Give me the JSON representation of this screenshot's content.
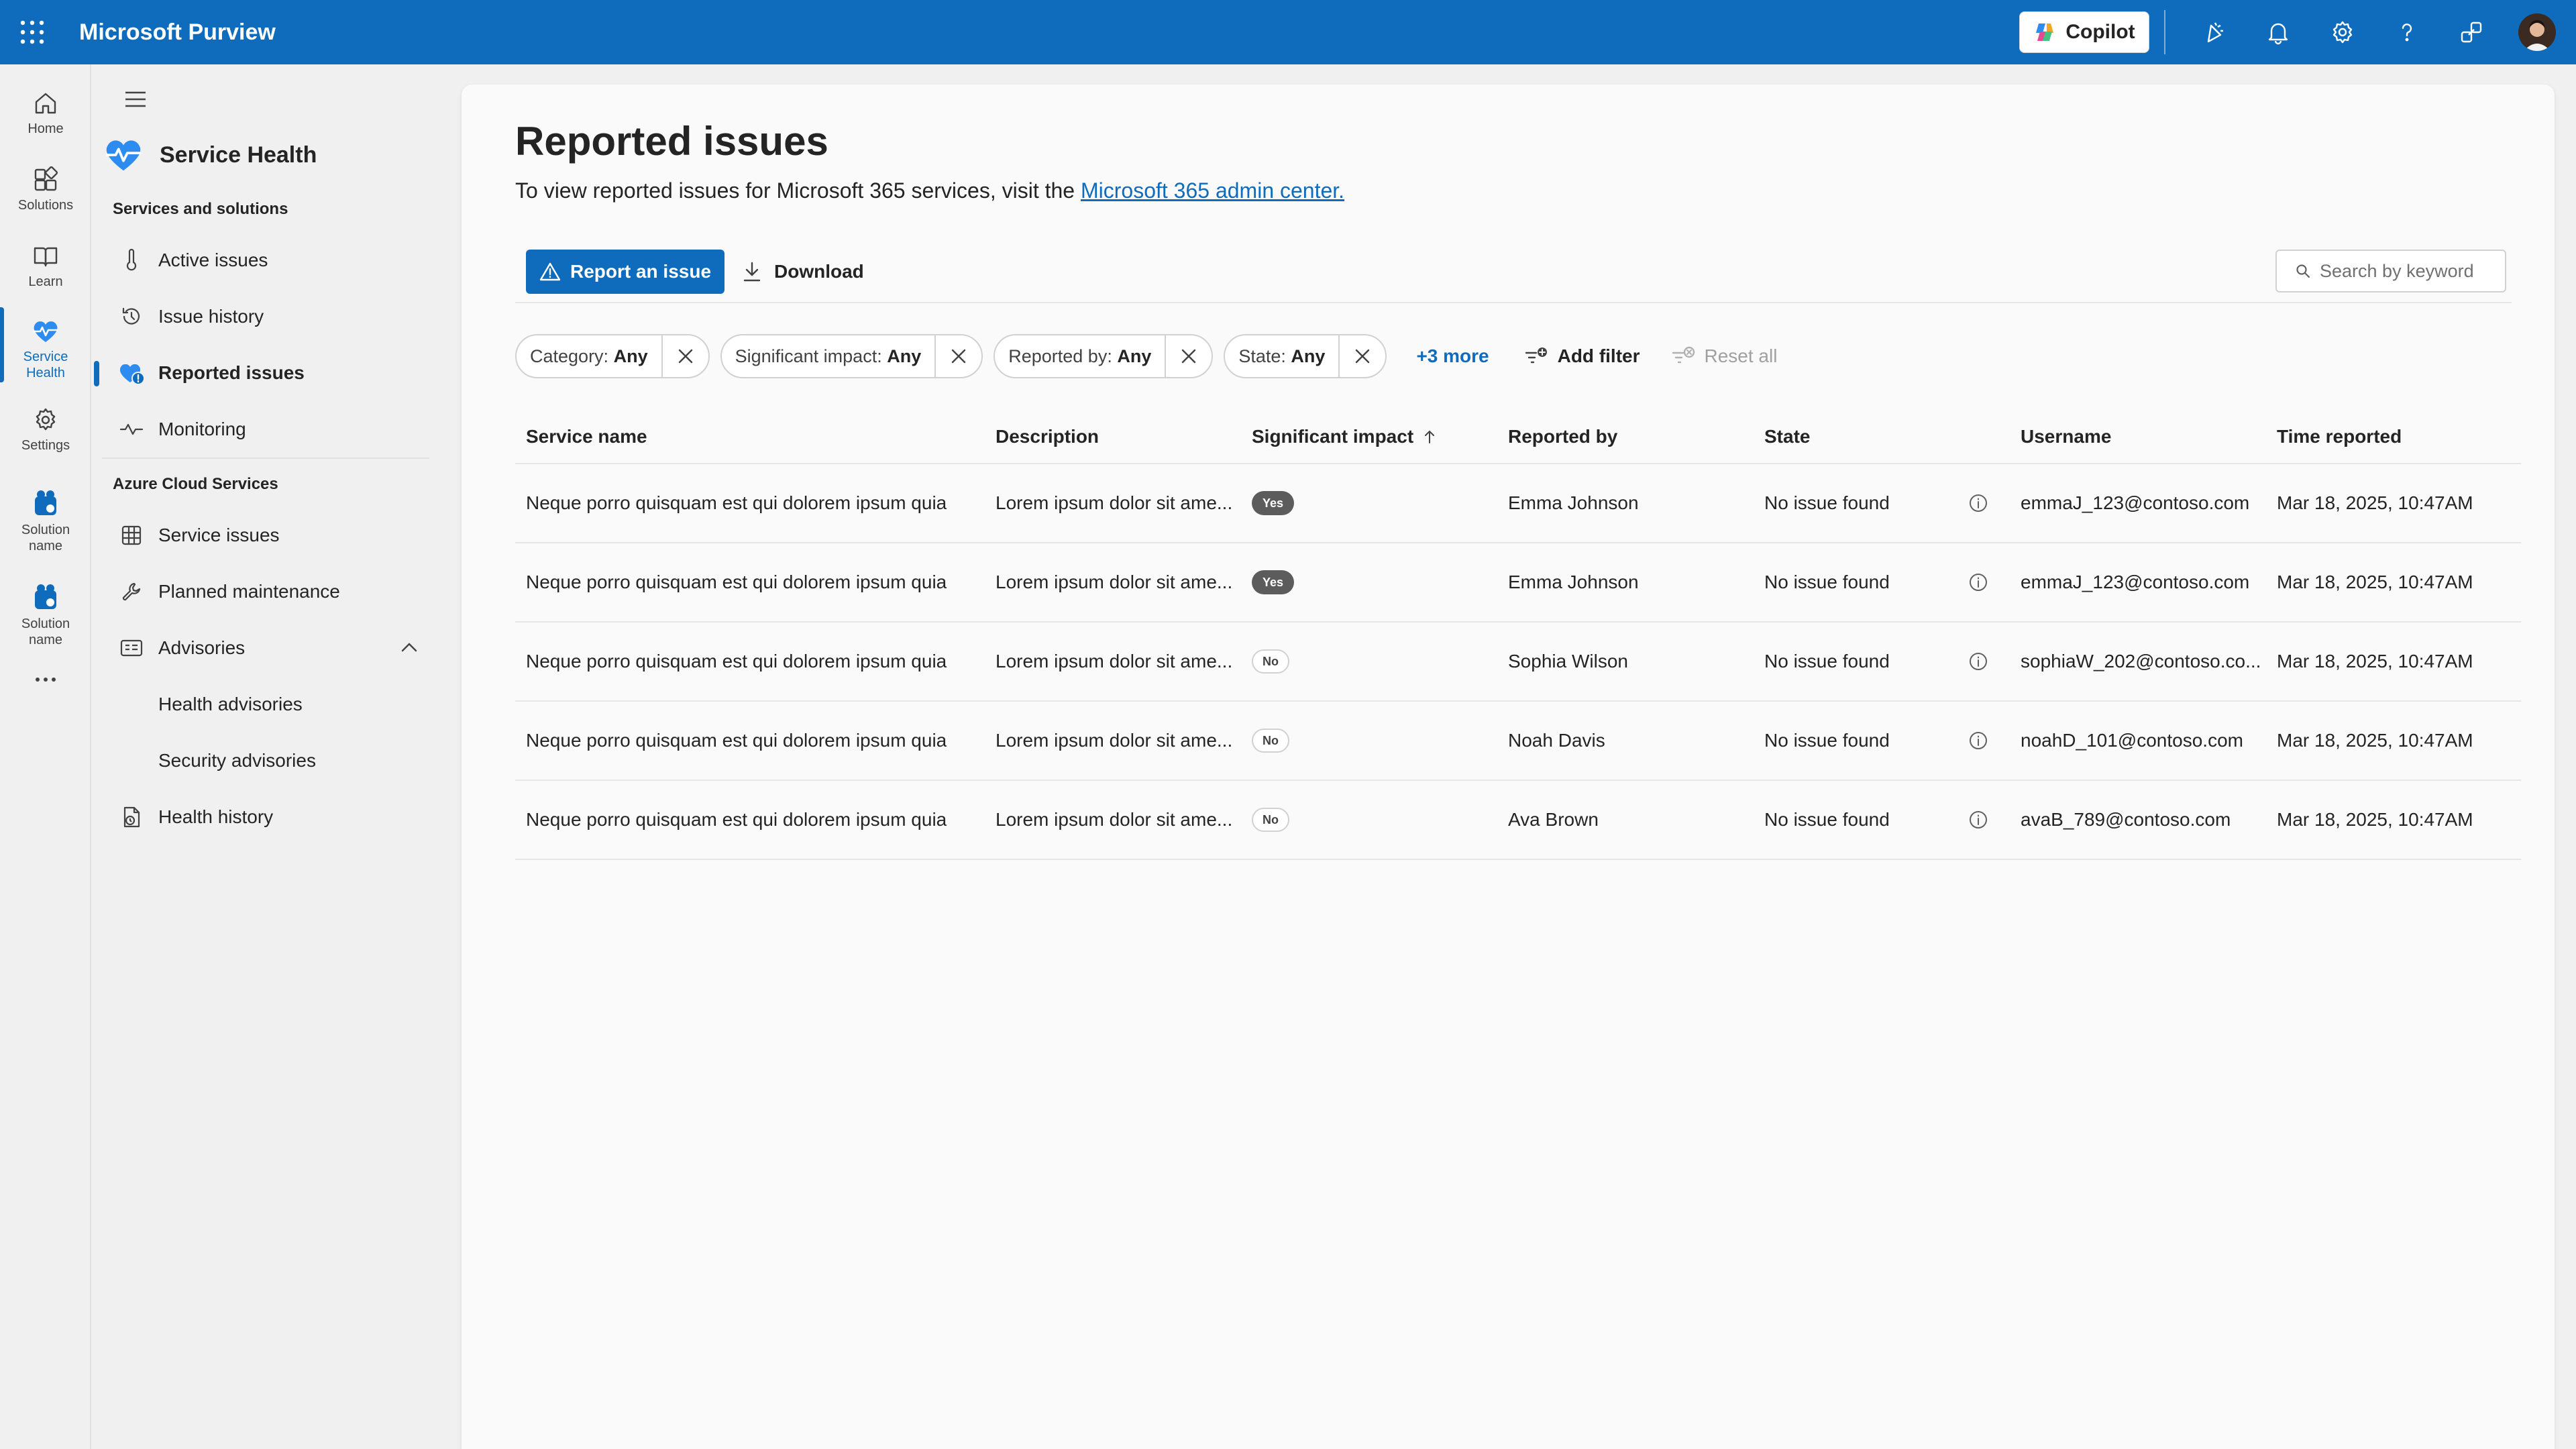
{
  "app": {
    "title": "Microsoft Purview"
  },
  "topbar": {
    "copilot_label": "Copilot"
  },
  "rail": {
    "items": [
      {
        "label": "Home",
        "icon": "home-icon"
      },
      {
        "label": "Solutions",
        "icon": "solutions-icon"
      },
      {
        "label": "Learn",
        "icon": "book-icon"
      },
      {
        "label": "Service Health",
        "icon": "heart-pulse-icon",
        "active": true
      },
      {
        "label": "Settings",
        "icon": "gear-icon"
      },
      {
        "label": "Solution name",
        "icon": "solution-icon"
      },
      {
        "label": "Solution name",
        "icon": "solution-icon"
      }
    ]
  },
  "nav": {
    "title": "Service Health",
    "section1": "Services and solutions",
    "section2": "Azure Cloud Services",
    "items": [
      {
        "label": "Active issues"
      },
      {
        "label": "Issue history"
      },
      {
        "label": "Reported issues",
        "active": true
      },
      {
        "label": "Monitoring"
      },
      {
        "label": "Service issues"
      },
      {
        "label": "Planned maintenance"
      },
      {
        "label": "Advisories",
        "expanded": true
      },
      {
        "label": "Health advisories"
      },
      {
        "label": "Security advisories"
      },
      {
        "label": "Health history"
      }
    ]
  },
  "main": {
    "title": "Reported issues",
    "subtitle_prefix": "To view reported issues for Microsoft 365 services, visit the ",
    "subtitle_link": "Microsoft 365 admin center.",
    "report_button": "Report an issue",
    "download_button": "Download",
    "search_placeholder": "Search by keyword",
    "filters": [
      {
        "label": "Category:",
        "value": "Any"
      },
      {
        "label": "Significant impact:",
        "value": "Any"
      },
      {
        "label": "Reported by:",
        "value": "Any"
      },
      {
        "label": "State:",
        "value": "Any"
      }
    ],
    "more_filters": "+3 more",
    "add_filter": "Add filter",
    "reset_all": "Reset all"
  },
  "table": {
    "columns": [
      "Service name",
      "Description",
      "Significant impact",
      "Reported by",
      "State",
      "Username",
      "Time reported"
    ],
    "rows": [
      {
        "service": "Neque porro quisquam est qui dolorem ipsum quia",
        "description": "Lorem ipsum dolor sit ame...",
        "impact": "Yes",
        "reported_by": "Emma Johnson",
        "state": "No issue found",
        "username": "emmaJ_123@contoso.com",
        "time": "Mar 18, 2025, 10:47AM"
      },
      {
        "service": "Neque porro quisquam est qui dolorem ipsum quia",
        "description": "Lorem ipsum dolor sit ame...",
        "impact": "Yes",
        "reported_by": "Emma Johnson",
        "state": "No issue found",
        "username": "emmaJ_123@contoso.com",
        "time": "Mar 18, 2025, 10:47AM"
      },
      {
        "service": "Neque porro quisquam est qui dolorem ipsum quia",
        "description": "Lorem ipsum dolor sit ame...",
        "impact": "No",
        "reported_by": "Sophia Wilson",
        "state": "No issue found",
        "username": "sophiaW_202@contoso.co...",
        "time": "Mar 18, 2025, 10:47AM"
      },
      {
        "service": "Neque porro quisquam est qui dolorem ipsum quia",
        "description": "Lorem ipsum dolor sit ame...",
        "impact": "No",
        "reported_by": "Noah Davis",
        "state": "No issue found",
        "username": "noahD_101@contoso.com",
        "time": "Mar 18, 2025, 10:47AM"
      },
      {
        "service": "Neque porro quisquam est qui dolorem ipsum quia",
        "description": "Lorem ipsum dolor sit ame...",
        "impact": "No",
        "reported_by": "Ava Brown",
        "state": "No issue found",
        "username": "avaB_789@contoso.com",
        "time": "Mar 18, 2025, 10:47AM"
      }
    ]
  },
  "colors": {
    "brand": "#0f6cbd",
    "badge_yes": "#5c5c5c"
  }
}
